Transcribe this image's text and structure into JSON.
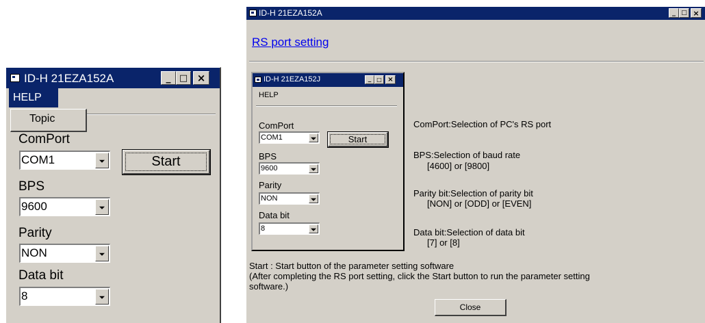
{
  "left_window": {
    "title": "ID-H  21EZA152A",
    "menu": {
      "help": "HELP"
    },
    "dropdown": {
      "topic": "Topic"
    },
    "labels": {
      "comport": "ComPort",
      "bps": "BPS",
      "parity": "Parity",
      "databit": "Data bit"
    },
    "values": {
      "comport": "COM1",
      "bps": "9600",
      "parity": "NON",
      "databit": "8"
    },
    "start_label": "Start"
  },
  "main_window": {
    "title": "ID-H 21EZA152A",
    "heading": "RS port setting",
    "inner": {
      "title": "ID-H  21EZA152J",
      "menu_help": "HELP",
      "labels": {
        "comport": "ComPort",
        "bps": "BPS",
        "parity": "Parity",
        "databit": "Data bit"
      },
      "values": {
        "comport": "COM1",
        "bps": "9600",
        "parity": "NON",
        "databit": "8"
      },
      "start_label": "Start"
    },
    "descriptions": {
      "comport": "ComPort:Selection of PC's RS port",
      "bps_1": "BPS:Selection of baud rate",
      "bps_2": "[4600] or [9800]",
      "parity_1": "Parity bit:Selection of parity bit",
      "parity_2": "[NON] or [ODD] or [EVEN]",
      "databit_1": "Data bit:Selection of data bit",
      "databit_2": "[7] or [8]"
    },
    "start_note_1": "Start : Start button of the parameter setting software",
    "start_note_2": "(After completing the RS port setting, click the Start button to run the parameter setting",
    "start_note_3": "software.)",
    "close_label": "Close"
  }
}
